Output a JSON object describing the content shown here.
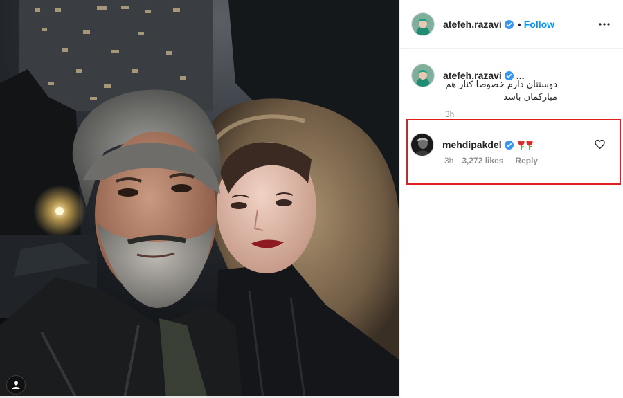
{
  "post": {
    "author": {
      "username": "atefeh.razavi",
      "verified": true,
      "follow_label": "Follow",
      "separator": "•",
      "more_icon": "more-horizontal-icon"
    },
    "caption": {
      "username": "atefeh.razavi",
      "truncation": "...",
      "text_line1": "دوستتان دارم خصوصا کنار هم",
      "text_line2": "مبارکمان باشد",
      "time": "3h"
    },
    "photo": {
      "tag_icon": "user-tag-icon"
    }
  },
  "comments": [
    {
      "username": "mehdipakdel",
      "verified": true,
      "text_icons": [
        "rose-icon",
        "rose-icon"
      ],
      "time": "3h",
      "likes": "3,272 likes",
      "reply_label": "Reply",
      "like_icon": "heart-icon",
      "highlight_color": "#e02020"
    }
  ],
  "colors": {
    "link_blue": "#0095f6",
    "verified_blue": "#3897f0",
    "meta_gray": "#8e8e8e",
    "border": "#efefef"
  }
}
